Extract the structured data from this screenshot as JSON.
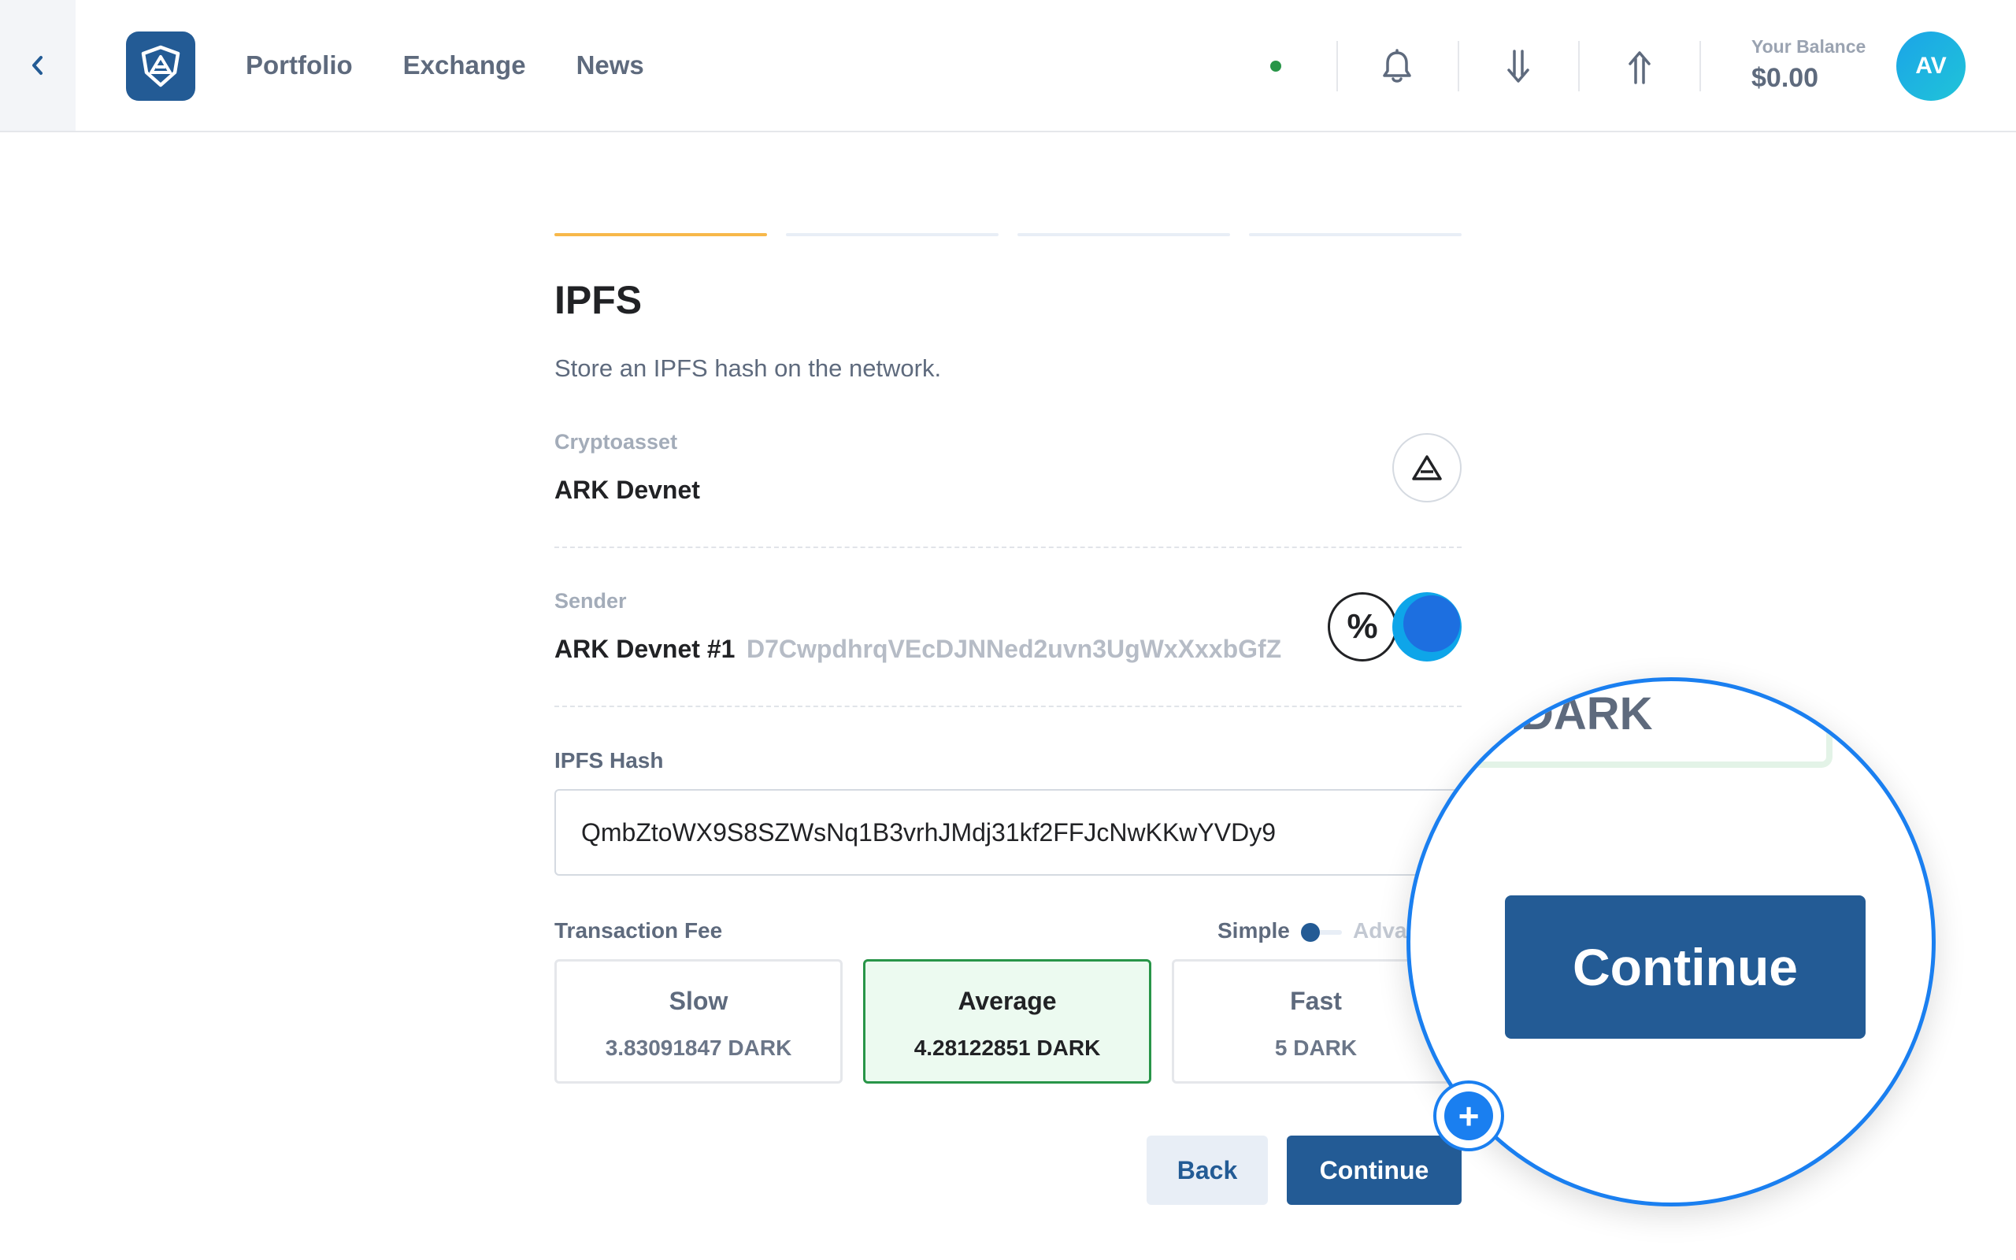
{
  "header": {
    "nav": [
      "Portfolio",
      "Exchange",
      "News"
    ],
    "balance_label": "Your Balance",
    "balance_value": "$0.00",
    "avatar_initials": "AV"
  },
  "steps": {
    "total": 4,
    "current": 1
  },
  "page": {
    "title": "IPFS",
    "description": "Store an IPFS hash on the network."
  },
  "cryptoasset": {
    "label": "Cryptoasset",
    "value": "ARK Devnet"
  },
  "sender": {
    "label": "Sender",
    "name": "ARK Devnet #1",
    "address": "D7CwpdhrqVEcDJNNed2uvn3UgWxXxxbGfZ"
  },
  "ipfs": {
    "label": "IPFS Hash",
    "value": "QmbZtoWX9S8SZWsNq1B3vrhJMdj31kf2FFJcNwKKwYVDy9"
  },
  "fee": {
    "label": "Transaction Fee",
    "toggle_simple": "Simple",
    "toggle_advanced": "Adva",
    "options": [
      {
        "name": "Slow",
        "amount": "3.83091847 DARK"
      },
      {
        "name": "Average",
        "amount": "4.28122851 DARK"
      },
      {
        "name": "Fast",
        "amount": "5 DARK"
      }
    ],
    "selected": 1
  },
  "actions": {
    "back": "Back",
    "continue": "Continue"
  },
  "magnifier": {
    "unit": "DARK",
    "button": "Continue"
  },
  "colors": {
    "brand": "#235b95",
    "accent_step": "#f7b84a",
    "selected_fee_border": "#289548",
    "selected_fee_bg": "#ecfaf0",
    "magnifier_ring": "#1a7ff0",
    "status_online": "#289548"
  },
  "icons": [
    "chevron-left-icon",
    "ark-logo-icon",
    "bell-icon",
    "arrow-down-icon",
    "arrow-up-icon",
    "ark-asset-icon",
    "percent-icon",
    "zoom-in-icon"
  ]
}
